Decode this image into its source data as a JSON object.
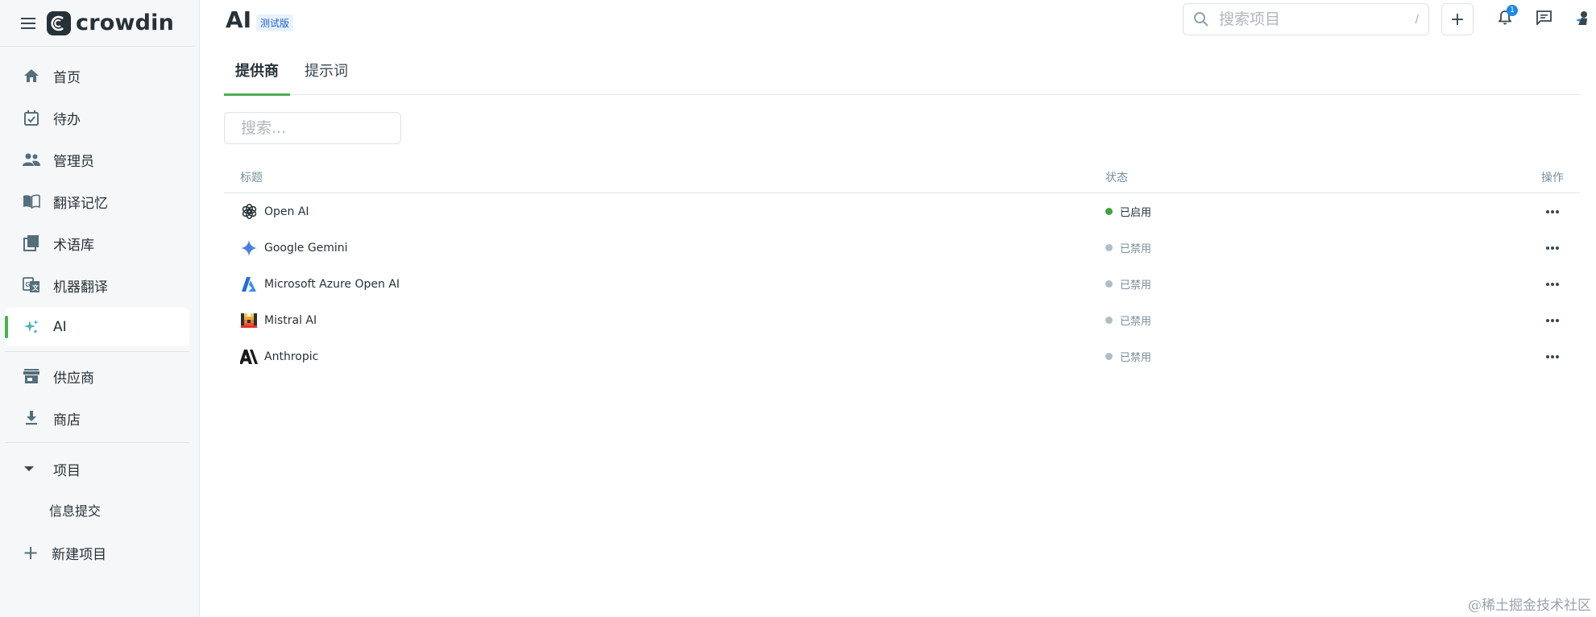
{
  "brand": {
    "name": "crowdin"
  },
  "sidebar": {
    "items": [
      {
        "label": "首页",
        "icon": "home-icon"
      },
      {
        "label": "待办",
        "icon": "calendar-check-icon"
      },
      {
        "label": "管理员",
        "icon": "people-icon"
      },
      {
        "label": "翻译记忆",
        "icon": "book-icon"
      },
      {
        "label": "术语库",
        "icon": "library-icon"
      },
      {
        "label": "机器翻译",
        "icon": "translate-icon"
      },
      {
        "label": "AI",
        "icon": "sparkle-icon",
        "active": true
      }
    ],
    "items2": [
      {
        "label": "供应商",
        "icon": "store-icon"
      },
      {
        "label": "商店",
        "icon": "download-icon"
      }
    ],
    "projects": {
      "label": "项目",
      "sub_item": "信息提交"
    },
    "new_project": "新建项目"
  },
  "header": {
    "title": "AI",
    "badge": "测试版",
    "search_placeholder": "搜索项目",
    "search_shortcut": "/",
    "add_label": "+",
    "notification_count": "1"
  },
  "tabs": [
    {
      "label": "提供商",
      "active": true
    },
    {
      "label": "提示词",
      "active": false
    }
  ],
  "filter": {
    "placeholder": "搜索..."
  },
  "table": {
    "columns": {
      "title": "标题",
      "status": "状态",
      "actions": "操作"
    },
    "rows": [
      {
        "name": "Open AI",
        "status": "已启用",
        "enabled": true,
        "icon": "openai-icon"
      },
      {
        "name": "Google Gemini",
        "status": "已禁用",
        "enabled": false,
        "icon": "gemini-icon"
      },
      {
        "name": "Microsoft Azure Open AI",
        "status": "已禁用",
        "enabled": false,
        "icon": "azure-icon"
      },
      {
        "name": "Mistral AI",
        "status": "已禁用",
        "enabled": false,
        "icon": "mistral-icon"
      },
      {
        "name": "Anthropic",
        "status": "已禁用",
        "enabled": false,
        "icon": "anthropic-icon"
      }
    ]
  },
  "colors": {
    "accent": "#4caf50",
    "enabled_dot": "#43a047",
    "disabled_dot": "#b0bec5",
    "badge_text": "#1e63c4"
  },
  "watermark": "@稀土掘金技术社区"
}
